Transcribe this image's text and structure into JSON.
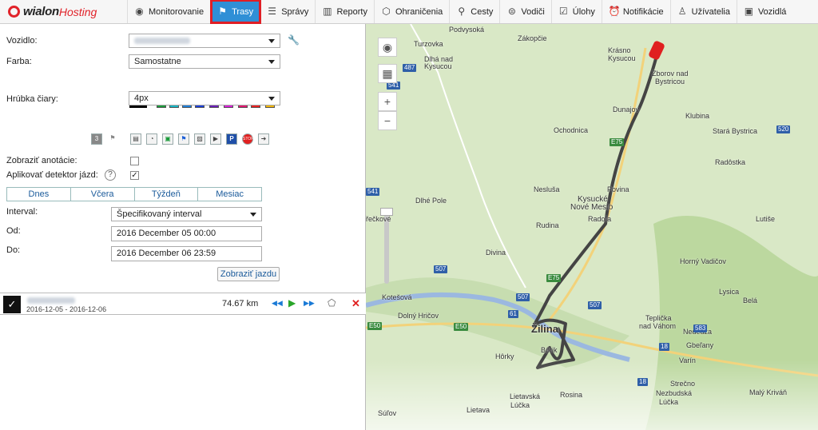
{
  "nav": {
    "brand": "wialon",
    "brand_suffix": "Hosting",
    "items": [
      {
        "label": "Monitorovanie",
        "icon": "globe-icon"
      },
      {
        "label": "Trasy",
        "icon": "flag-icon"
      },
      {
        "label": "Správy",
        "icon": "list-icon"
      },
      {
        "label": "Reporty",
        "icon": "chart-icon"
      },
      {
        "label": "Ohraničenia",
        "icon": "polygon-icon"
      },
      {
        "label": "Cesty",
        "icon": "route-icon"
      },
      {
        "label": "Vodiči",
        "icon": "steering-icon"
      },
      {
        "label": "Úlohy",
        "icon": "task-icon"
      },
      {
        "label": "Notifikácie",
        "icon": "alarm-icon"
      },
      {
        "label": "Užívatelia",
        "icon": "user-icon"
      },
      {
        "label": "Vozidlá",
        "icon": "bus-icon"
      }
    ]
  },
  "form": {
    "vehicle_label": "Vozidlo:",
    "color_label": "Farba:",
    "color_value": "Samostatne",
    "line_label": "Hrúbka čiary:",
    "line_value": "4px",
    "tool_badge": "3",
    "annotations_label": "Zobraziť anotácie:",
    "detector_label": "Aplikovať detektor jázd:",
    "help_glyph": "?",
    "tabs": [
      "Dnes",
      "Včera",
      "Týždeň",
      "Mesiac"
    ],
    "interval_label": "Interval:",
    "interval_value": "Špecifikovaný interval",
    "from_label": "Od:",
    "from_value": "2016 December 05 00:00",
    "to_label": "Do:",
    "to_value": "2016 December 06 23:59",
    "submit": "Zobraziť jazdu"
  },
  "swatches": [
    "#000000",
    "#1a9a3a",
    "#17b5c4",
    "#1f7fd8",
    "#1b3fd6",
    "#6a1fb5",
    "#d61fd6",
    "#e0166e",
    "#e82020",
    "#f0b400"
  ],
  "trip": {
    "dates": "2016-12-05 - 2016-12-06",
    "distance": "74.67 km"
  },
  "map": {
    "labels": [
      {
        "t": "Podvysoká"
      },
      {
        "t": "Turzovka"
      },
      {
        "t": "Zákopčie"
      },
      {
        "t": "Dlhá nad"
      },
      {
        "t": "Kysucou"
      },
      {
        "t": "Krásno"
      },
      {
        "t": "Kysucou"
      },
      {
        "t": "Zborov nad"
      },
      {
        "t": "Bystricou"
      },
      {
        "t": "Dunajov"
      },
      {
        "t": "Klubina"
      },
      {
        "t": "Ochodnica"
      },
      {
        "t": "Stará Bystrica"
      },
      {
        "t": "Radôstka"
      },
      {
        "t": "Nesluša"
      },
      {
        "t": "Povina"
      },
      {
        "t": "Kysucké"
      },
      {
        "t": "Nové Mesto"
      },
      {
        "t": "Dlhé Pole"
      },
      {
        "t": "Radoľa"
      },
      {
        "t": "Rudina"
      },
      {
        "t": "Lutiše"
      },
      {
        "t": "řečkové"
      },
      {
        "t": "Divina"
      },
      {
        "t": "Horný Vadičov"
      },
      {
        "t": "Kotešová"
      },
      {
        "t": "Lysica"
      },
      {
        "t": "Belá"
      },
      {
        "t": "Dolný Hričov"
      },
      {
        "t": "Teplička"
      },
      {
        "t": "nad Váhom"
      },
      {
        "t": "Nededza"
      },
      {
        "t": "Žilina"
      },
      {
        "t": "Gbeľany"
      },
      {
        "t": "Bôrik"
      },
      {
        "t": "Hôrky"
      },
      {
        "t": "Varín"
      },
      {
        "t": "Strečno"
      },
      {
        "t": "Nezbudská"
      },
      {
        "t": "Lúčka"
      },
      {
        "t": "Malý Kriváň"
      },
      {
        "t": "Lietavská"
      },
      {
        "t": "Lúčka"
      },
      {
        "t": "Rosina"
      },
      {
        "t": "Lietava"
      },
      {
        "t": "Súľov"
      }
    ],
    "roads": [
      "487",
      "541",
      "520",
      "E75",
      "E75",
      "541",
      "507",
      "507",
      "507",
      "E50",
      "61",
      "583",
      "18",
      "18",
      "E50"
    ]
  }
}
